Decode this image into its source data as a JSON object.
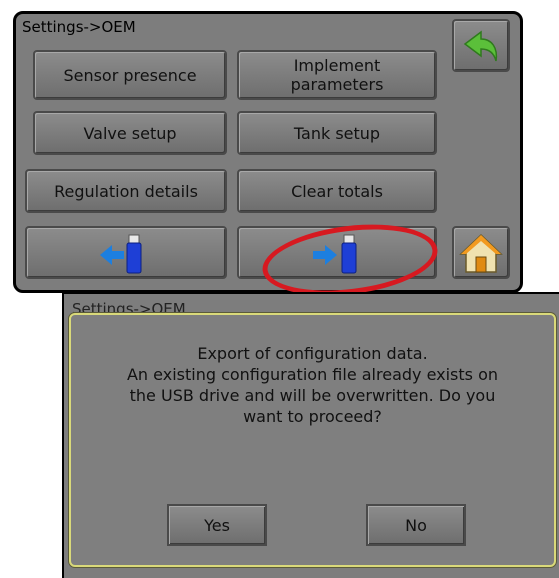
{
  "screen": {
    "title": "Settings->OEM",
    "buttons": {
      "sensor_presence": "Sensor presence",
      "implement_parameters_line1": "Implement",
      "implement_parameters_line2": "parameters",
      "valve_setup": "Valve setup",
      "tank_setup": "Tank setup",
      "regulation_details": "Regulation details",
      "clear_totals": "Clear totals"
    },
    "icons": {
      "back": "back-arrow-icon",
      "home": "home-icon",
      "import_usb": "usb-import-icon",
      "export_usb": "usb-export-icon"
    }
  },
  "background_screen": {
    "title": "Settings->OEM"
  },
  "dialog": {
    "lines": [
      "Export of configuration data.",
      "An existing configuration file already exists on",
      "the USB drive and will be overwritten. Do you",
      "want to proceed?"
    ],
    "yes_label": "Yes",
    "no_label": "No"
  },
  "colors": {
    "panel": "#7d7d7d",
    "highlight_oval": "#d71920",
    "usb_blue": "#1e3fd6",
    "arrow_blue": "#1d7fe0",
    "back_arrow_green": "#5bbf3a",
    "dialog_border": "#d9d97a"
  }
}
